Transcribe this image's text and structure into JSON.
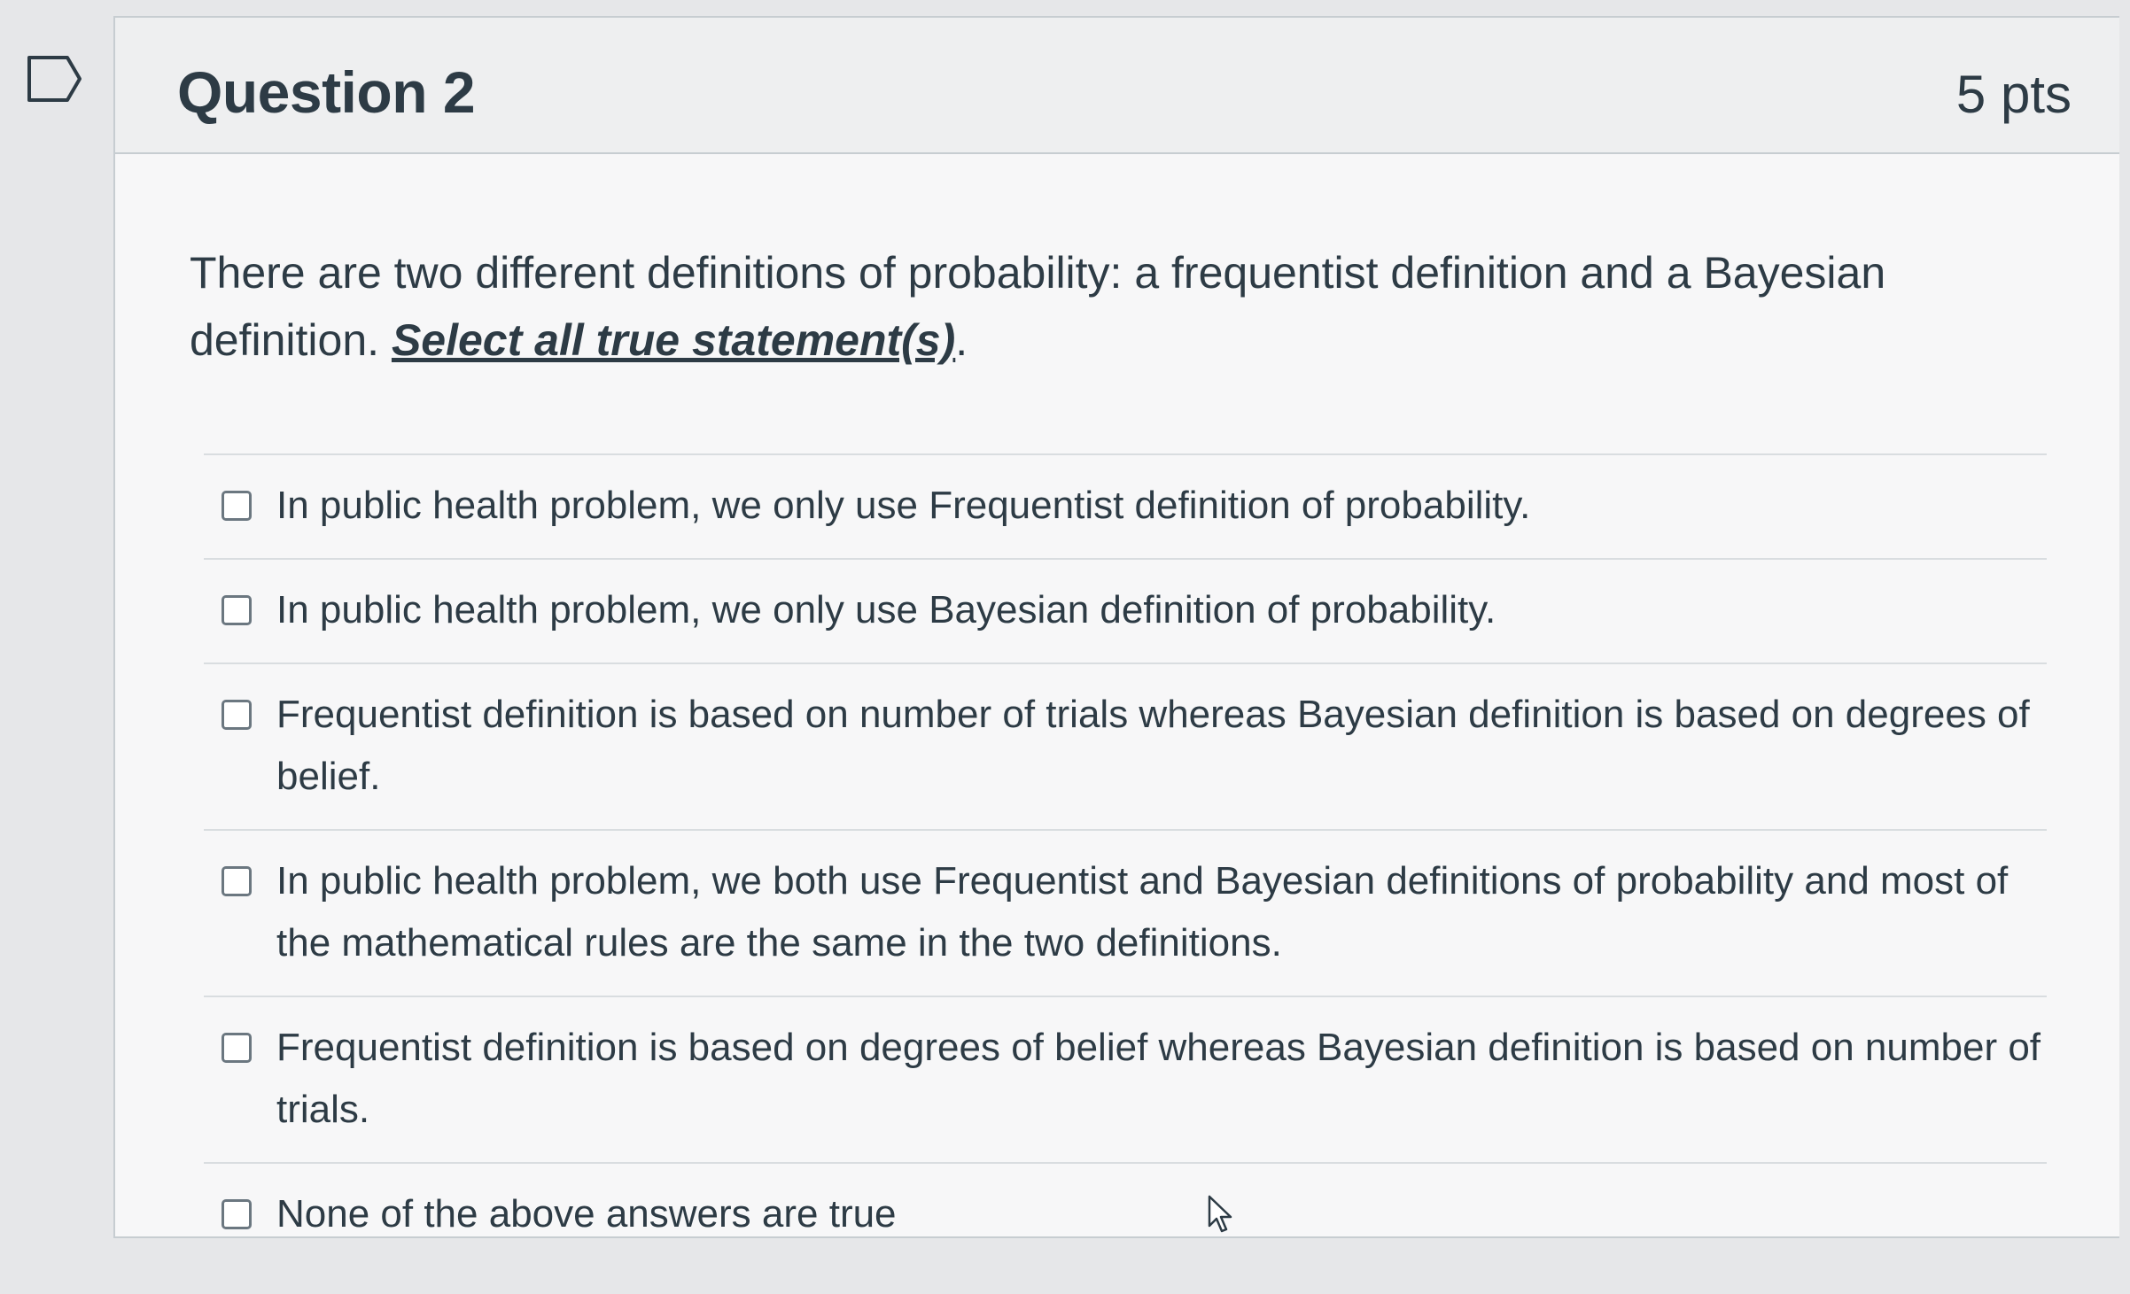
{
  "question": {
    "title": "Question 2",
    "points": "5 pts",
    "prompt": "There are two different definitions of probability: a frequentist definition and a Bayesian definition. ",
    "instruction": "Select all true statement(s)",
    "instruction_suffix": "."
  },
  "answers": [
    {
      "label": "In public health problem, we only use Frequentist definition of probability."
    },
    {
      "label": "In public health problem, we only use Bayesian definition of probability."
    },
    {
      "label": "Frequentist definition is based on number of trials whereas Bayesian definition is based on degrees of belief."
    },
    {
      "label": "In public health problem, we both use Frequentist and Bayesian definitions of probability and most of the mathematical rules are the same in the two definitions."
    },
    {
      "label": "Frequentist definition is based on degrees of belief whereas Bayesian definition is based on number of trials."
    },
    {
      "label": "None of the above answers are true"
    }
  ],
  "icons": {
    "flag": "flag-icon",
    "checkbox": "checkbox-icon",
    "cursor": "mouse-pointer-icon"
  },
  "colors": {
    "text": "#2d3b45",
    "background": "#e6e7e9",
    "header": "#eeeff0",
    "border": "#c7cdd1"
  }
}
